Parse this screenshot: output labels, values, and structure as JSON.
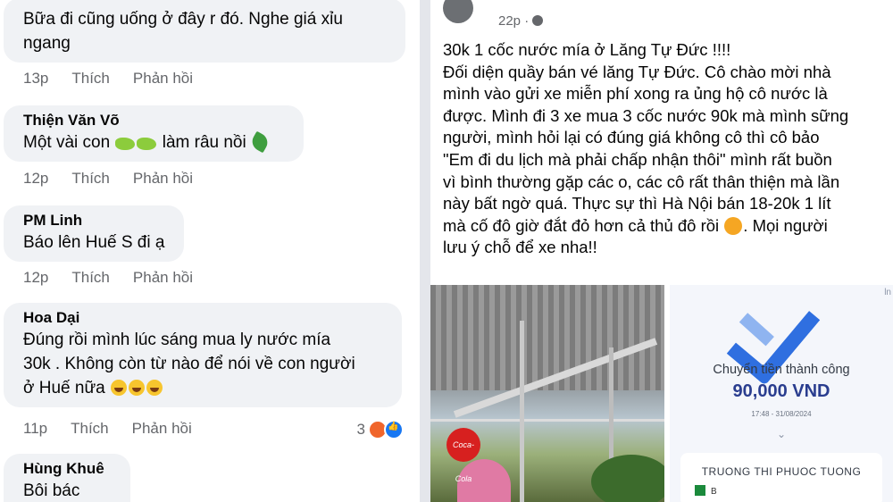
{
  "comments": [
    {
      "name": "",
      "text": "Bữa đi cũng uống ở đây r đó. Nghe giá xỉu ngang",
      "time": "13p",
      "like": "Thích",
      "reply": "Phản hồi"
    },
    {
      "name": "Thiện Văn Võ",
      "text": "Một vài con",
      "text_after": "làm râu nồi",
      "time": "12p",
      "like": "Thích",
      "reply": "Phản hồi",
      "emojis": [
        "caterpillar",
        "caterpillar",
        "leafy-green"
      ]
    },
    {
      "name": "PM Linh",
      "text": "Báo lên Huế S đi ạ",
      "time": "12p",
      "like": "Thích",
      "reply": "Phản hồi"
    },
    {
      "name": "Hoa Dại",
      "line1": "Đúng rồi mình lúc sáng mua ly nước mía",
      "line2": "30k . Không còn từ nào để nói về con người",
      "line3": "ở Huế nữa",
      "time": "11p",
      "like": "Thích",
      "reply": "Phản hồi",
      "reaction_count": "3",
      "emojis": [
        "laughing-face",
        "laughing-face",
        "laughing-face"
      ]
    },
    {
      "name": "Hùng Khuê",
      "text": "Bôi bác"
    }
  ],
  "post": {
    "time": "22p ·",
    "paragraph1": "30k 1 cốc nước mía ở Lăng Tự Đức !!!!",
    "lines": [
      "Đối diện quầy bán vé lăng Tự Đức. Cô chào mời nhà",
      "mình vào gửi xe miễn phí xong ra ủng hộ cô nước là",
      "được. Mình đi 3 xe mua 3 cốc nước 90k mà mình sững",
      "người, mình hỏi lại có đúng giá không cô thì cô bảo",
      "\"Em đi du lịch mà phải chấp nhận thôi\" mình rất buồn",
      "vì bình thường gặp các o, các cô rất thân thiện mà lần",
      "này bất ngờ quá. Thực sự thì Hà Nội bán 18-20k 1 lít",
      "mà cố đô giờ đắt đỏ hơn cả thủ đô rồi",
      "lưu ý chỗ để xe nha!!"
    ],
    "line8_after": ". Mọi người",
    "photo_sign": "Coca-Cola"
  },
  "receipt": {
    "title": "Chuyển tiền thành công",
    "amount": "90,000 VND",
    "datetime": "17:48 - 31/08/2024",
    "recipient": "TRUONG THI PHUOC TUONG",
    "bank": "B",
    "logo_text": "ln"
  },
  "colors": {
    "meta_gray": "#65676b",
    "bubble_bg": "#f0f2f5",
    "brand_blue": "#1877f2",
    "amount_blue": "#2a3d8f"
  }
}
